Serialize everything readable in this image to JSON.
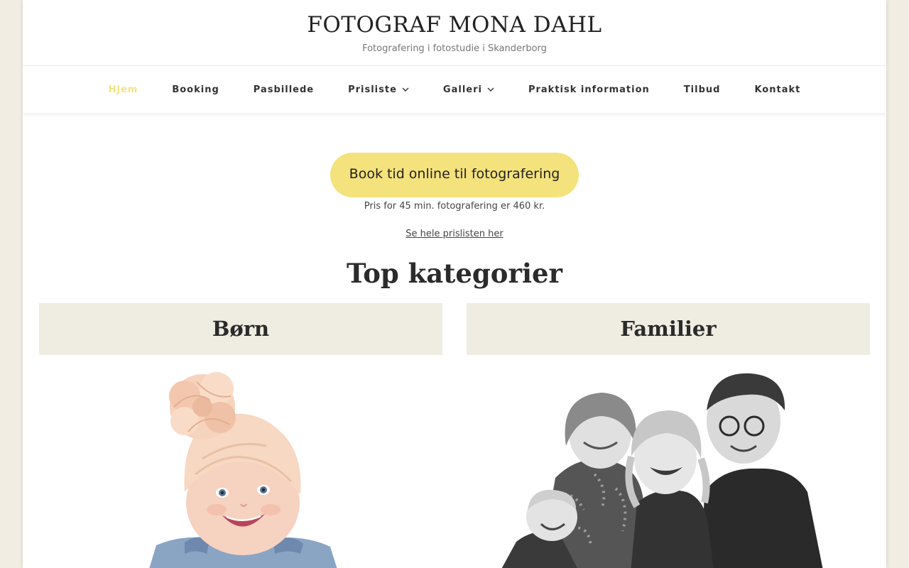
{
  "site": {
    "title": "FOTOGRAF MONA DAHL",
    "tagline": "Fotografering i fotostudie i Skanderborg"
  },
  "nav": {
    "items": [
      {
        "label": "Hjem",
        "active": true,
        "has_dropdown": false
      },
      {
        "label": "Booking",
        "active": false,
        "has_dropdown": false
      },
      {
        "label": "Pasbillede",
        "active": false,
        "has_dropdown": false
      },
      {
        "label": "Prisliste",
        "active": false,
        "has_dropdown": true
      },
      {
        "label": "Galleri",
        "active": false,
        "has_dropdown": true
      },
      {
        "label": "Praktisk information",
        "active": false,
        "has_dropdown": false
      },
      {
        "label": "Tilbud",
        "active": false,
        "has_dropdown": false
      },
      {
        "label": "Kontakt",
        "active": false,
        "has_dropdown": false
      }
    ]
  },
  "hero": {
    "cta_label": "Book tid online til fotografering",
    "price_note": "Pris for 45 min. fotografering er 460 kr.",
    "price_link": "Se hele prislisten her"
  },
  "categories": {
    "title": "Top kategorier",
    "items": [
      {
        "label": "Børn",
        "photo": "baby-portrait"
      },
      {
        "label": "Familier",
        "photo": "family-portrait-bw"
      }
    ]
  },
  "colors": {
    "accent": "#f4e27c",
    "background": "#f1ede2",
    "card_bar": "#efece1"
  }
}
